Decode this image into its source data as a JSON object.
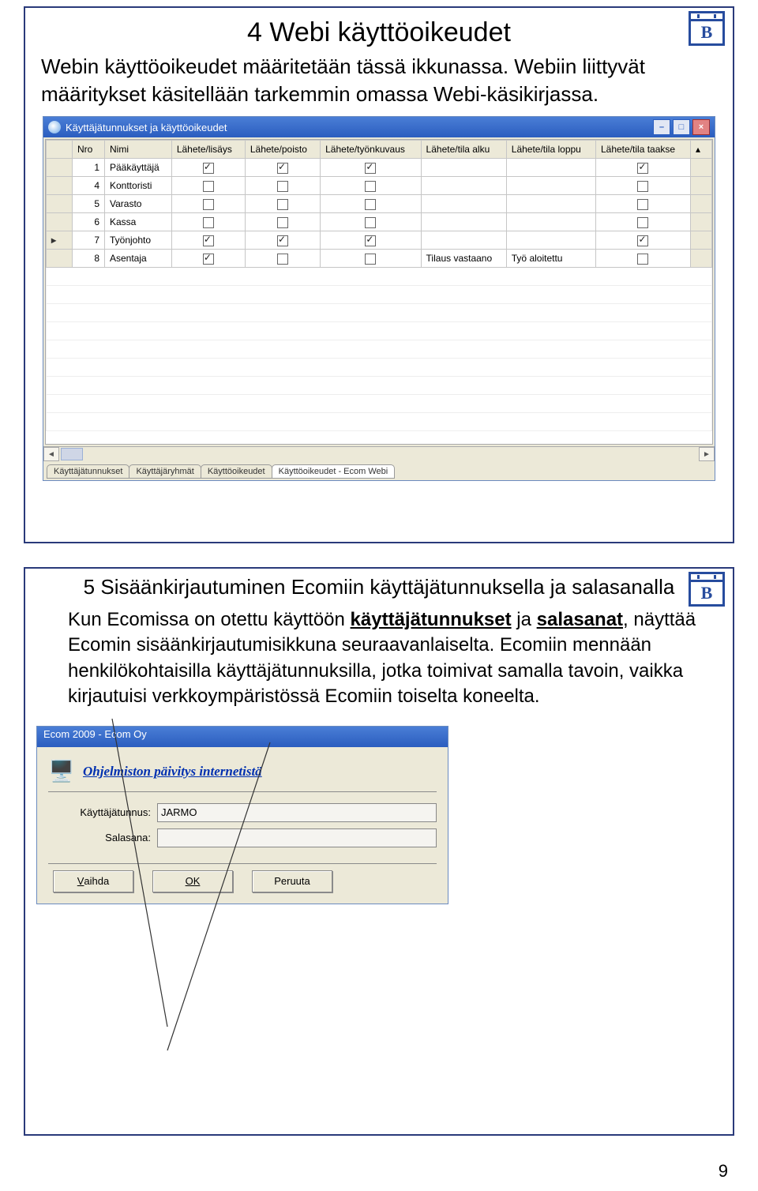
{
  "page_number": "9",
  "logo_letter": "B",
  "slide1": {
    "title": "4 Webi käyttöoikeudet",
    "text": "Webin käyttöoikeudet määritetään tässä ikkunassa. Webiin liittyvät määritykset käsitellään tarkemmin omassa Webi-käsikirjassa.",
    "window_title": "Käyttäjätunnukset ja käyttöoikeudet",
    "columns": [
      "Nro",
      "Nimi",
      "Lähete/lisäys",
      "Lähete/poisto",
      "Lähete/työnkuvaus",
      "Lähete/tila alku",
      "Lähete/tila loppu",
      "Lähete/tila taakse"
    ],
    "rows": [
      {
        "mark": "",
        "nro": "1",
        "nimi": "Pääkäyttäjä",
        "c": [
          true,
          true,
          true,
          "",
          "",
          true
        ]
      },
      {
        "mark": "",
        "nro": "4",
        "nimi": "Konttoristi",
        "c": [
          false,
          false,
          false,
          "",
          "",
          false
        ]
      },
      {
        "mark": "",
        "nro": "5",
        "nimi": "Varasto",
        "c": [
          false,
          false,
          false,
          "",
          "",
          false
        ]
      },
      {
        "mark": "",
        "nro": "6",
        "nimi": "Kassa",
        "c": [
          false,
          false,
          false,
          "",
          "",
          false
        ]
      },
      {
        "mark": "▸",
        "nro": "7",
        "nimi": "Työnjohto",
        "c": [
          true,
          true,
          true,
          "",
          "",
          true
        ]
      },
      {
        "mark": "",
        "nro": "8",
        "nimi": "Asentaja",
        "c": [
          true,
          false,
          false,
          "Tilaus vastaano",
          "Työ aloitettu",
          false
        ]
      }
    ],
    "tabs": [
      "Käyttäjätunnukset",
      "Käyttäjäryhmät",
      "Käyttöoikeudet",
      "Käyttöoikeudet - Ecom Webi"
    ]
  },
  "slide2": {
    "title": "5 Sisäänkirjautuminen Ecomiin käyttäjätunnuksella ja salasanalla",
    "text_pre": "Kun Ecomissa on otettu käyttöön ",
    "kw1": "käyttäjätunnukset",
    "mid": " ja ",
    "kw2": "salasanat",
    "text_post": ", näyttää Ecomin sisäänkirjautumisikkuna seuraavanlaiselta. Ecomiin mennään henkilökohtaisilla käyttäjätunnuksilla, jotka toimivat samalla tavoin, vaikka kirjautuisi verkkoympäristössä Ecomiin toiselta koneelta.",
    "login_title": "Ecom 2009 - Ecom Oy",
    "headline": "Ohjelmiston päivitys internetistä",
    "label_user": "Käyttäjätunnus:",
    "label_pass": "Salasana:",
    "user_value": "JARMO",
    "pass_value": "",
    "btn_change": "Vaihda",
    "btn_ok": "OK",
    "btn_cancel": "Peruuta"
  }
}
